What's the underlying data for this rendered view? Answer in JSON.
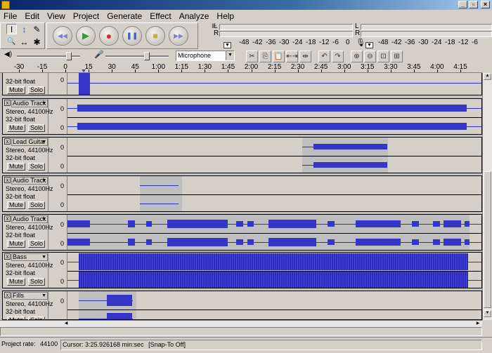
{
  "window": {
    "minimize": "_",
    "restore": "▫",
    "close": "×"
  },
  "menu": [
    "File",
    "Edit",
    "View",
    "Project",
    "Generate",
    "Effect",
    "Analyze",
    "Help"
  ],
  "tools": {
    "selection": "I",
    "envelope": "↕",
    "draw": "✎",
    "zoom": "🔍",
    "timeshift": "↔",
    "multi": "✱"
  },
  "transport": {
    "rewind": "◀◀",
    "play": "▶",
    "record": "●",
    "pause": "❚❚",
    "stop": "■",
    "ffwd": "▶▶"
  },
  "meters": {
    "play_label": "L",
    "play_label_r": "R",
    "scale": [
      "-48",
      "-42",
      "-36",
      "-30",
      "-24",
      "-18",
      "-12",
      "-6",
      "0"
    ]
  },
  "mixer": {
    "input_source": "Microphone"
  },
  "edit_tools": [
    "✂",
    "⎘",
    "📋",
    "⇤⇥",
    "⇹",
    "↶",
    "↷",
    "⊕",
    "⊖",
    "⊡",
    "⊞"
  ],
  "ruler": {
    "labels": [
      "-30",
      "-15",
      "0",
      "15",
      "30",
      "45",
      "1:00",
      "1:15",
      "1:30",
      "1:45",
      "2:00",
      "2:15",
      "2:30",
      "2:45",
      "3:00",
      "3:15",
      "3:30",
      "3:45",
      "4:00",
      "4:15"
    ]
  },
  "tracks": [
    {
      "name": "",
      "line1": "",
      "line2": "32-bit float",
      "mute": "Mute",
      "solo": "Solo",
      "scale_top": "0",
      "scale_bot": "",
      "partial": true
    },
    {
      "name": "Audio Track",
      "line1": "Stereo, 44100Hz",
      "line2": "32-bit float",
      "mute": "Mute",
      "solo": "Solo",
      "scale_top": "0",
      "scale_bot": "0"
    },
    {
      "name": "Lead Guitar",
      "line1": "Stereo, 44100Hz",
      "line2": "32-bit float",
      "mute": "Mute",
      "solo": "Solo",
      "scale_top": "0",
      "scale_bot": "0"
    },
    {
      "name": "Audio Track",
      "line1": "Stereo, 44100Hz",
      "line2": "32-bit float",
      "mute": "Mute",
      "solo": "Solo",
      "scale_top": "0",
      "scale_bot": "0"
    },
    {
      "name": "Audio Track",
      "line1": "Stereo, 44100Hz",
      "line2": "32-bit float",
      "mute": "Mute",
      "solo": "Solo",
      "scale_top": "0",
      "scale_bot": "0"
    },
    {
      "name": "Bass",
      "line1": "Stereo, 44100Hz",
      "line2": "32-bit float",
      "mute": "Mute",
      "solo": "Solo",
      "scale_top": "0",
      "scale_bot": "0"
    },
    {
      "name": "Fills",
      "line1": "Stereo, 44100Hz",
      "line2": "32-bit float",
      "mute": "Mute",
      "solo": "Solo",
      "scale_top": "0",
      "scale_bot": ""
    }
  ],
  "status": {
    "project_rate_label": "Project rate:",
    "project_rate": "44100",
    "cursor": "Cursor: 3:25.926168 min:sec",
    "snap": "[Snap-To Off]"
  }
}
